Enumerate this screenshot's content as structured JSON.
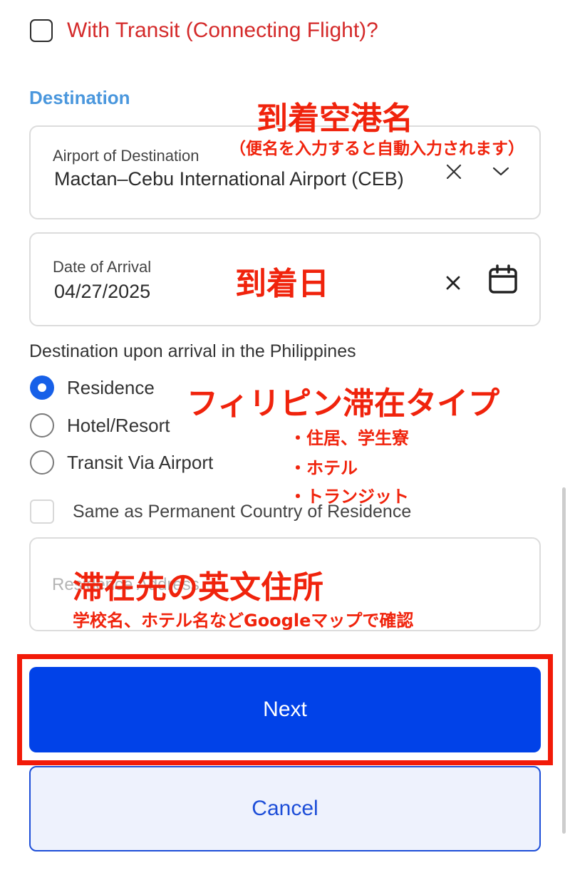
{
  "transit": {
    "label": "With Transit (Connecting Flight)?"
  },
  "destination": {
    "section_title": "Destination",
    "airport": {
      "label": "Airport of Destination",
      "value": "Mactan–Cebu International Airport (CEB)"
    },
    "date": {
      "label": "Date of Arrival",
      "value": "04/27/2025"
    }
  },
  "stay": {
    "question": "Destination upon arrival in the Philippines",
    "options": [
      {
        "label": "Residence",
        "selected": true
      },
      {
        "label": "Hotel/Resort",
        "selected": false
      },
      {
        "label": "Transit Via Airport",
        "selected": false
      }
    ],
    "same_as_label": "Same as Permanent Country of Residence",
    "address_placeholder": "Residence Address"
  },
  "buttons": {
    "next": "Next",
    "cancel": "Cancel"
  },
  "annotations": {
    "airport_title": "到着空港名",
    "airport_note": "（便名を入力すると自動入力されます）",
    "date_title": "到着日",
    "stay_type_title": "フィリピン滞在タイプ",
    "stay_type_items": [
      "・住居、学生寮",
      "・ホテル",
      "・トランジット"
    ],
    "address_title": "滞在先の英文住所",
    "address_note": "学校名、ホテル名などGoogleマップで確認"
  },
  "colors": {
    "primary": "#0142e8",
    "section_title": "#4a97dd",
    "transit_label": "#d42a2a",
    "annotation": "#f0230c"
  }
}
